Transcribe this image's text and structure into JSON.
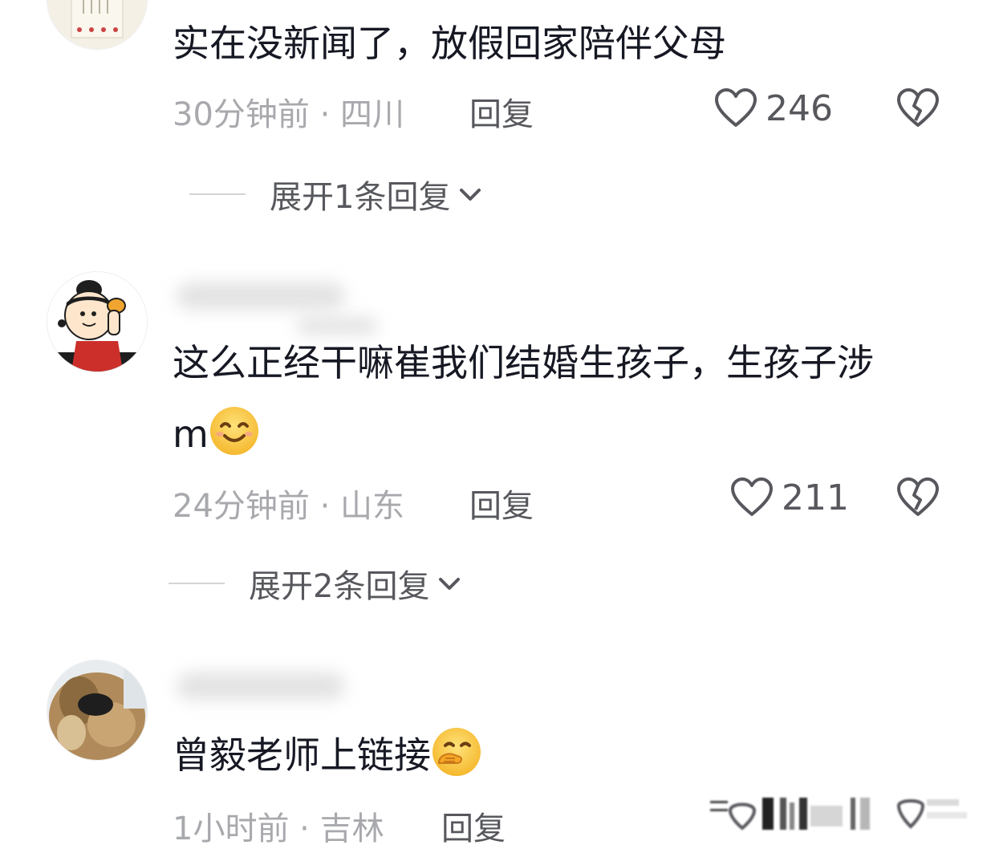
{
  "comments": [
    {
      "text": "实在没新闻了，放假回家陪伴父母",
      "time_location": "30分钟前 · 四川",
      "reply_label": "回复",
      "likes": "246",
      "expand_label": "展开1条回复"
    },
    {
      "text_line1": "这么正经干嘛崔我们结婚生孩子，生孩子涉",
      "text_line2": "m",
      "time_location": "24分钟前 · 山东",
      "reply_label": "回复",
      "likes": "211",
      "expand_label": "展开2条回复"
    },
    {
      "text": "曾毅老师上链接",
      "time_location": "1小时前 · 吉林",
      "reply_label": "回复"
    }
  ],
  "colors": {
    "primary_text": "#161823",
    "meta_text": "#a8a9ad",
    "secondary_text": "#57585d",
    "divider": "#d4d4d6"
  },
  "icons": [
    "heart-outline-icon",
    "broken-heart-icon",
    "chevron-down-icon",
    "smile-emoji",
    "hand-over-mouth-emoji"
  ]
}
